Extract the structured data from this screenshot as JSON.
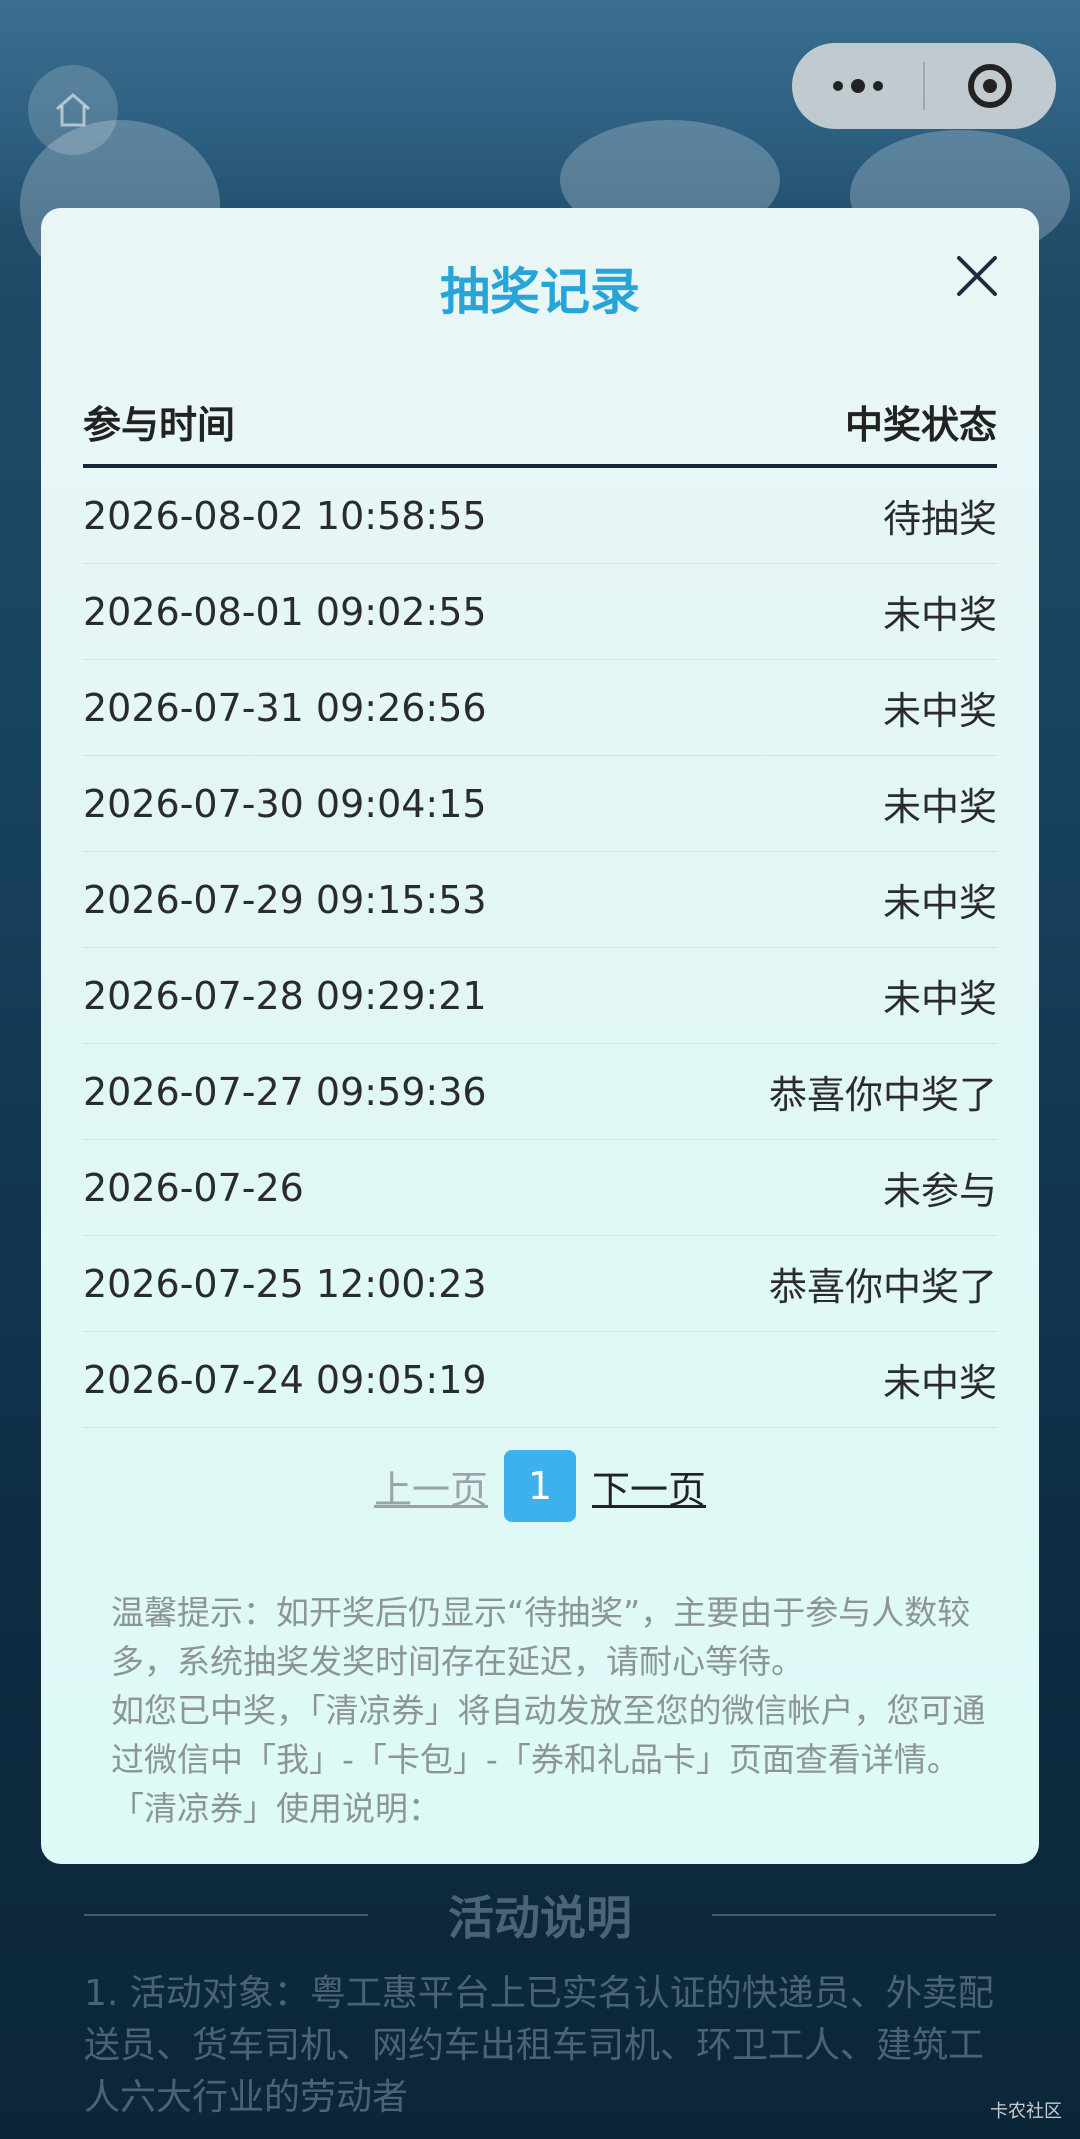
{
  "page": {
    "background_activity_title": "活动说明",
    "background_activity_desc": "1. 活动对象：粤工惠平台上已实名认证的快递员、外卖配送员、货车司机、网约车出租车司机、环卫工人、建筑工人六大行业的劳动者",
    "watermark": "卡农社区"
  },
  "capsule": {
    "more_icon": "more-dots-icon",
    "close_icon": "target-icon"
  },
  "modal": {
    "title": "抽奖记录",
    "close_icon": "close-x-icon",
    "table": {
      "headers": [
        "参与时间",
        "中奖状态"
      ],
      "rows": [
        {
          "time": "2026-08-02 10:58:55",
          "status": "待抽奖"
        },
        {
          "time": "2026-08-01 09:02:55",
          "status": "未中奖"
        },
        {
          "time": "2026-07-31 09:26:56",
          "status": "未中奖"
        },
        {
          "time": "2026-07-30 09:04:15",
          "status": "未中奖"
        },
        {
          "time": "2026-07-29 09:15:53",
          "status": "未中奖"
        },
        {
          "time": "2026-07-28 09:29:21",
          "status": "未中奖"
        },
        {
          "time": "2026-07-27 09:59:36",
          "status": "恭喜你中奖了"
        },
        {
          "time": "2026-07-26",
          "status": "未参与"
        },
        {
          "time": "2026-07-25 12:00:23",
          "status": "恭喜你中奖了"
        },
        {
          "time": "2026-07-24 09:05:19",
          "status": "未中奖"
        }
      ]
    },
    "pager": {
      "prev": "上一页",
      "current": "1",
      "next": "下一页"
    },
    "tips": [
      "温馨提示：如开奖后仍显示“待抽奖”，主要由于参与人数较多，系统抽奖发奖时间存在延迟，请耐心等待。",
      "如您已中奖，「清凉券」将自动发放至您的微信帐户，您可通过微信中「我」-「卡包」-「券和礼品卡」页面查看详情。",
      "「清凉券」使用说明："
    ]
  },
  "colors": {
    "title_blue": "#27a4d8",
    "page_button_blue": "#3cb1ee"
  }
}
